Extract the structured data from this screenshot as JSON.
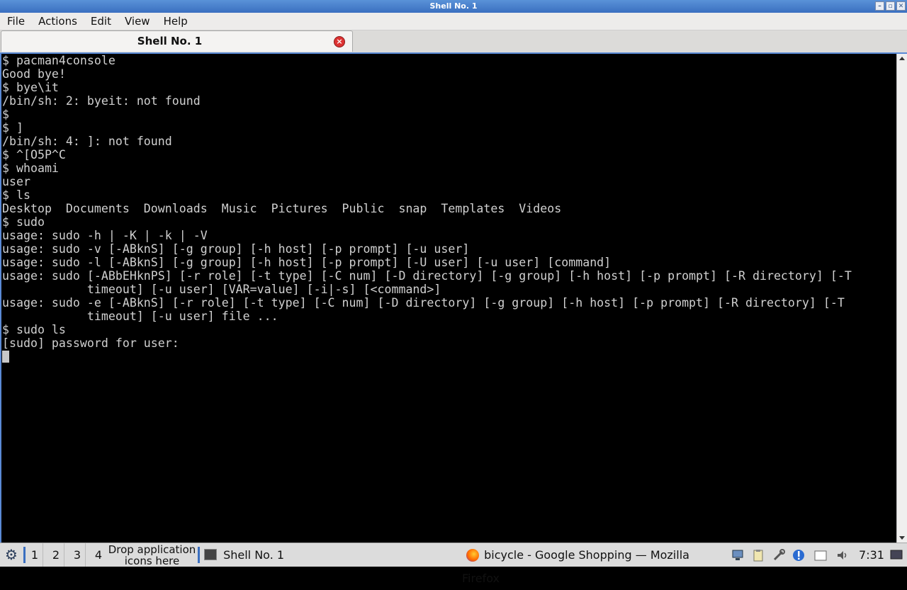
{
  "window": {
    "title": "Shell No. 1"
  },
  "menu": [
    "File",
    "Actions",
    "Edit",
    "View",
    "Help"
  ],
  "tab": {
    "label": "Shell No. 1"
  },
  "terminal": {
    "lines": [
      "$ pacman4console",
      "Good bye!",
      "$ bye\\it",
      "/bin/sh: 2: byeit: not found",
      "$",
      "$ ]",
      "/bin/sh: 4: ]: not found",
      "$ ^[O5P^C",
      "$ whoami",
      "user",
      "$ ls",
      "Desktop  Documents  Downloads  Music  Pictures  Public  snap  Templates  Videos",
      "$ sudo",
      "usage: sudo -h | -K | -k | -V",
      "usage: sudo -v [-ABknS] [-g group] [-h host] [-p prompt] [-u user]",
      "usage: sudo -l [-ABknS] [-g group] [-h host] [-p prompt] [-U user] [-u user] [command]",
      "usage: sudo [-ABbEHknPS] [-r role] [-t type] [-C num] [-D directory] [-g group] [-h host] [-p prompt] [-R directory] [-T",
      "            timeout] [-u user] [VAR=value] [-i|-s] [<command>]",
      "usage: sudo -e [-ABknS] [-r role] [-t type] [-C num] [-D directory] [-g group] [-h host] [-p prompt] [-R directory] [-T",
      "            timeout] [-u user] file ...",
      "$ sudo ls",
      "[sudo] password for user:"
    ]
  },
  "taskbar": {
    "desktops": [
      "1",
      "2",
      "3",
      "4"
    ],
    "drop_text_1": "Drop application",
    "drop_text_2": "icons here",
    "tasks": [
      {
        "label": "Shell No. 1",
        "icon": "terminal-icon"
      },
      {
        "label": "bicycle - Google Shopping — Mozilla Firefox",
        "icon": "firefox-icon"
      }
    ],
    "tray_icons": [
      "network-icon",
      "clipboard-icon",
      "tools-icon",
      "update-icon",
      "notes-icon",
      "volume-icon"
    ],
    "clock": "7:31"
  }
}
